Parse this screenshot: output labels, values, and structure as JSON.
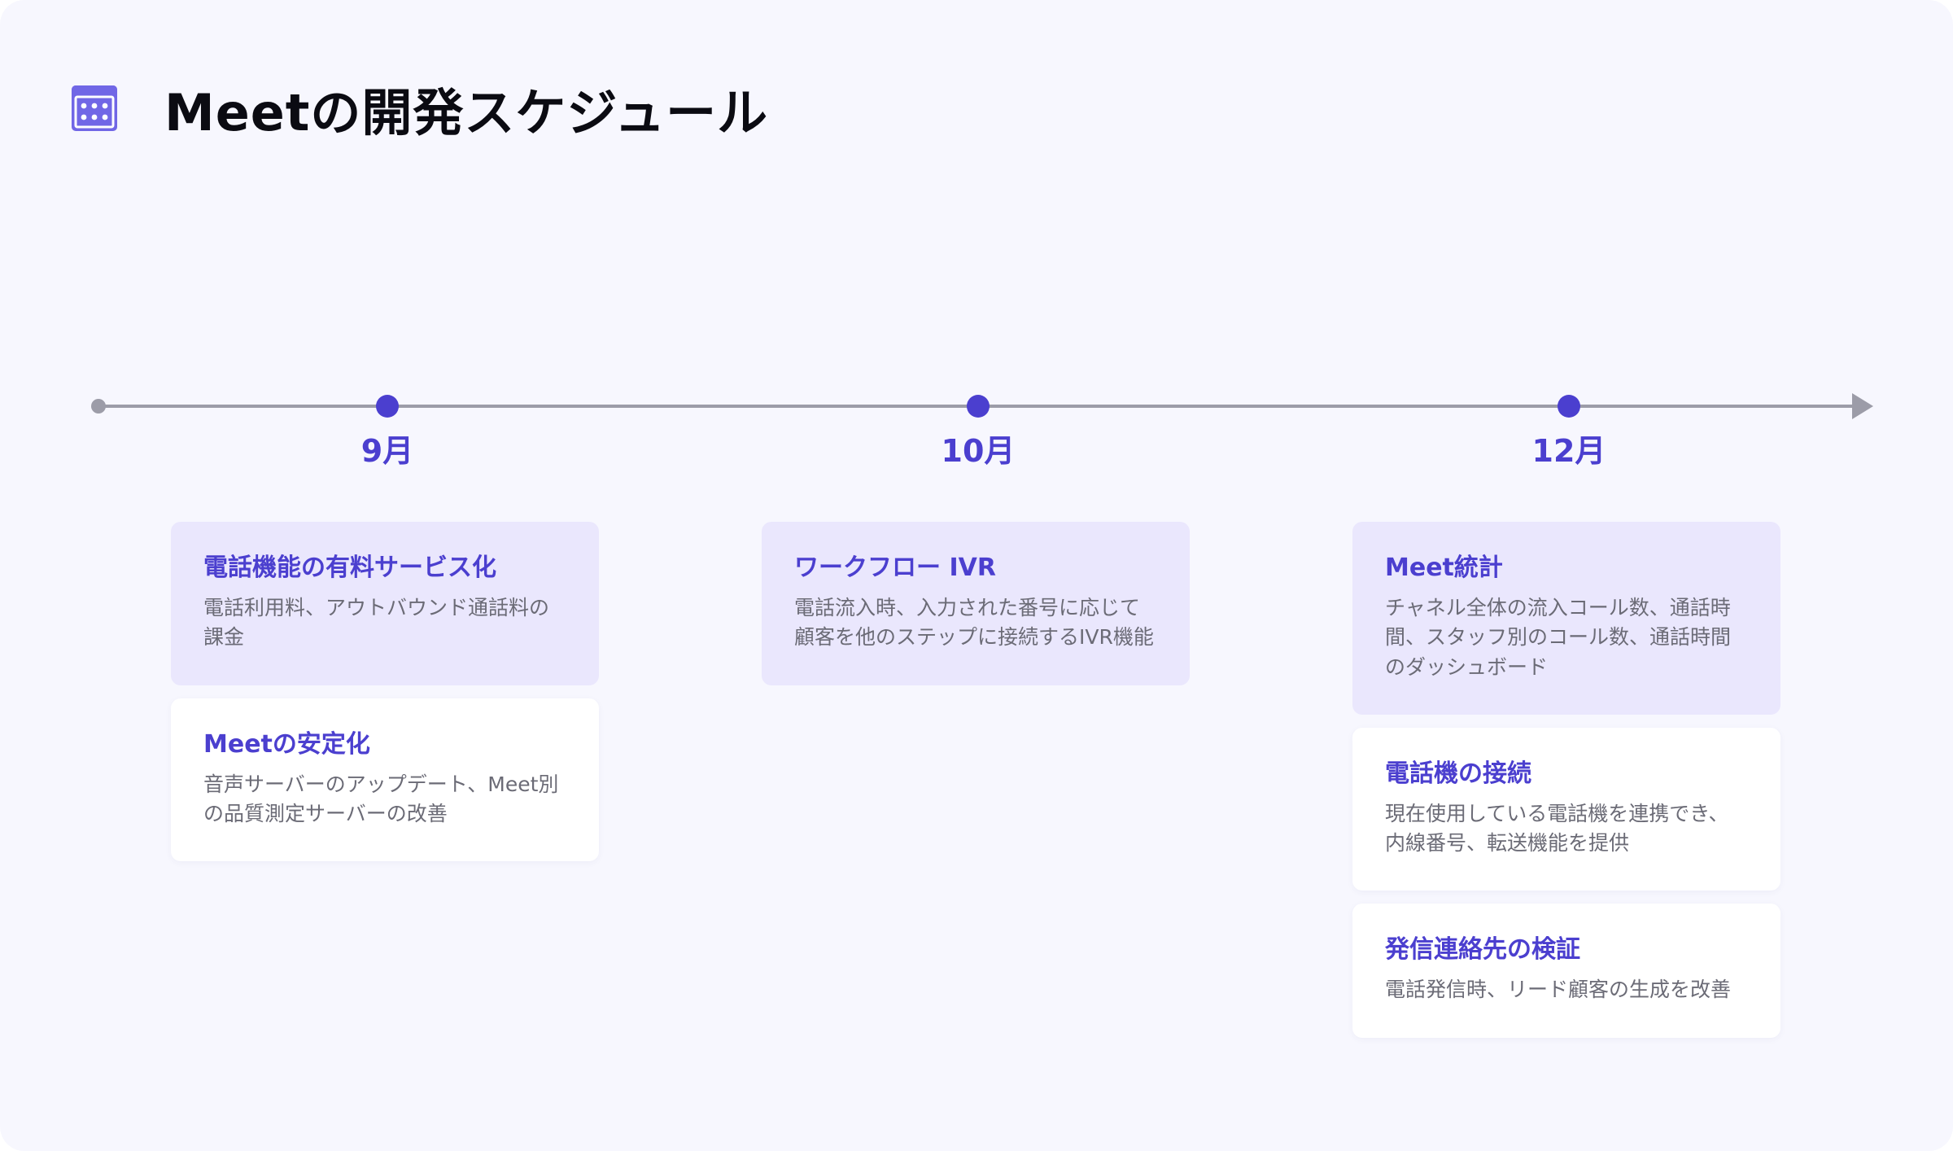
{
  "title": "Meetの開発スケジュール",
  "header_icon": "calendar-icon",
  "colors": {
    "accent": "#4b3fcf",
    "card_highlight": "#eae7fd",
    "card_plain": "#ffffff",
    "timeline": "#9c9ca8",
    "background": "#f7f7fe"
  },
  "milestones": [
    {
      "month": "9月",
      "cards": [
        {
          "title": "電話機能の有料サービス化",
          "description": "電話利用料、アウトバウンド通話料の課金",
          "style": "primary"
        },
        {
          "title": "Meetの安定化",
          "description": "音声サーバーのアップデート、Meet別の品質測定サーバーの改善",
          "style": "secondary"
        }
      ]
    },
    {
      "month": "10月",
      "cards": [
        {
          "title": "ワークフロー IVR",
          "description": "電話流入時、入力された番号に応じて顧客を他のステップに接続するIVR機能",
          "style": "primary"
        }
      ]
    },
    {
      "month": "12月",
      "cards": [
        {
          "title": "Meet統計",
          "description": "チャネル全体の流入コール数、通話時間、スタッフ別のコール数、通話時間のダッシュボード",
          "style": "primary"
        },
        {
          "title": "電話機の接続",
          "description": "現在使用している電話機を連携でき、内線番号、転送機能を提供",
          "style": "secondary"
        },
        {
          "title": "発信連絡先の検証",
          "description": "電話発信時、リード顧客の生成を改善",
          "style": "secondary"
        }
      ]
    }
  ]
}
